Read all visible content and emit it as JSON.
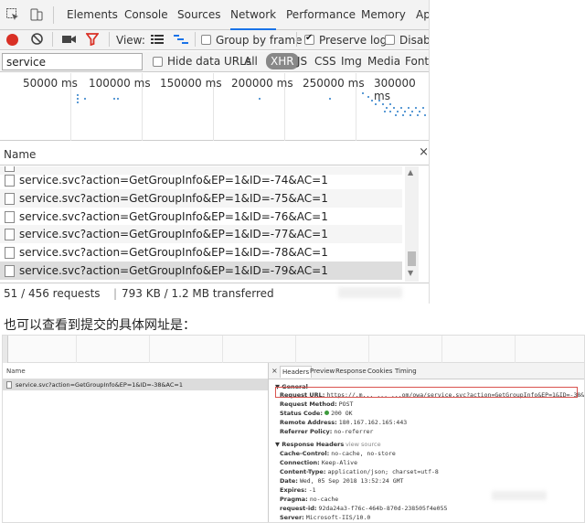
{
  "top": {
    "tabs": [
      {
        "label": "Elements"
      },
      {
        "label": "Console"
      },
      {
        "label": "Sources"
      },
      {
        "label": "Network",
        "active": true
      },
      {
        "label": "Performance"
      },
      {
        "label": "Memory"
      },
      {
        "label": "Ap"
      }
    ],
    "toolbar": {
      "view_label": "View:",
      "group_by_frame_label": "Group by frame",
      "group_by_frame_checked": false,
      "preserve_log_label": "Preserve log",
      "preserve_log_checked": true,
      "disable_label": "Disabl"
    },
    "filter": {
      "value": "service",
      "hide_data_urls_label": "Hide data URLs",
      "types": [
        "All",
        "XHR",
        "JS",
        "CSS",
        "Img",
        "Media",
        "Font"
      ],
      "selected_type": "XHR"
    },
    "overview": {
      "ticks": [
        "50000 ms",
        "100000 ms",
        "150000 ms",
        "200000 ms",
        "250000 ms",
        "300000 ms"
      ]
    },
    "name_header": "Name",
    "close_glyph": "×",
    "rows": [
      {
        "label": ""
      },
      {
        "label": "service.svc?action=GetGroupInfo&EP=1&ID=-74&AC=1"
      },
      {
        "label": "service.svc?action=GetGroupInfo&EP=1&ID=-75&AC=1"
      },
      {
        "label": "service.svc?action=GetGroupInfo&EP=1&ID=-76&AC=1"
      },
      {
        "label": "service.svc?action=GetGroupInfo&EP=1&ID=-77&AC=1"
      },
      {
        "label": "service.svc?action=GetGroupInfo&EP=1&ID=-78&AC=1"
      },
      {
        "label": "service.svc?action=GetGroupInfo&EP=1&ID=-79&AC=1",
        "selected": true
      }
    ],
    "status": {
      "requests": "51 / 456 requests",
      "separator": "|",
      "transferred": "793 KB / 1.2 MB transferred"
    }
  },
  "caption": "也可以查看到提交的具体网址是：",
  "bottom": {
    "name_header": "Name",
    "row_label": "service.svc?action=GetGroupInfo&EP=1&ID=-38&AC=1",
    "tabs": [
      "Headers",
      "Preview",
      "Response",
      "Cookies",
      "Timing"
    ],
    "active_tab": "Headers",
    "general": {
      "title": "▼ General",
      "request_url_key": "Request URL:",
      "request_url_value": "https://.m...  ...  ...om/owa/service.svc?action=GetGroupInfo&EP=1&ID=-38&AC=1",
      "request_method_key": "Request Method:",
      "request_method_value": "POST",
      "status_code_key": "Status Code:",
      "status_code_value": "200 OK",
      "remote_address_key": "Remote Address:",
      "remote_address_value": "180.167.162.165:443",
      "referrer_policy_key": "Referrer Policy:",
      "referrer_policy_value": "no-referrer"
    },
    "response_headers": {
      "title": "▼ Response Headers",
      "view_source": "view source",
      "items": [
        {
          "k": "Cache-Control:",
          "v": "no-cache, no-store"
        },
        {
          "k": "Connection:",
          "v": "Keep-Alive"
        },
        {
          "k": "Content-Type:",
          "v": "application/json; charset=utf-8"
        },
        {
          "k": "Date:",
          "v": "Wed, 05 Sep 2018 13:52:24 GMT"
        },
        {
          "k": "Expires:",
          "v": "-1"
        },
        {
          "k": "Pragma:",
          "v": "no-cache"
        },
        {
          "k": "request-id:",
          "v": "92da24a3-f76c-464b-870d-238505f4e055"
        },
        {
          "k": "Server:",
          "v": "Microsoft-IIS/10.0"
        }
      ]
    }
  },
  "colors": {
    "record": "#d93025",
    "filter_icon": "#d93025",
    "active_tab_underline": "#1a73e8",
    "highlight_box": "#d9534f",
    "status_ok": "#3c9a3c"
  }
}
